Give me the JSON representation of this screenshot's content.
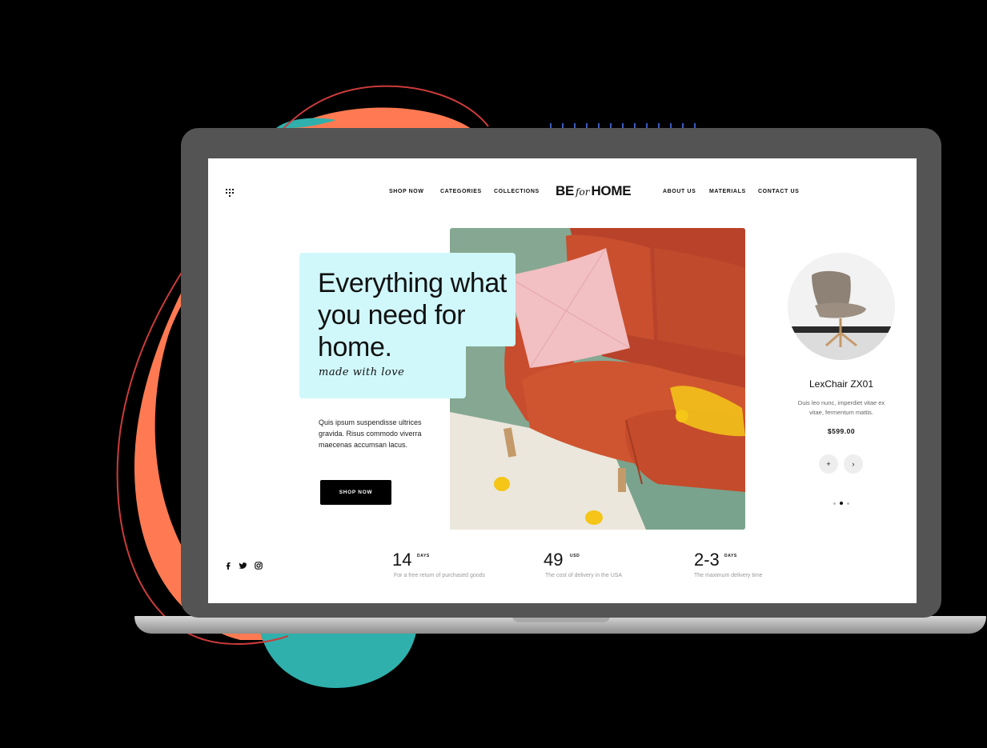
{
  "nav": {
    "left": [
      "SHOP NOW",
      "CATEGORIES",
      "COLLECTIONS"
    ],
    "right": [
      "ABOUT US",
      "MATERIALS",
      "CONTACT US"
    ]
  },
  "logo": {
    "part1": "BE",
    "part2": "for",
    "part3": "HOME"
  },
  "hero": {
    "title": "Everything what you need for home.",
    "script": "made with love",
    "description": "Quis ipsum suspendisse ultrices gravida. Risus commodo viverra maecenas accumsan lacus.",
    "button": "SHOP NOW"
  },
  "product": {
    "name": "LexChair ZX01",
    "description": "Duis leo nunc, imperdiet vitae ex vitae, fermentum mattis.",
    "price": "$599.00",
    "add_label": "+",
    "next_label": "›"
  },
  "stats": [
    {
      "value": "14",
      "unit": "DAYS",
      "label": "For a free return of purchased goods"
    },
    {
      "value": "49",
      "unit": "USD",
      "label": "The cost of delivery in the USA"
    },
    {
      "value": "2-3",
      "unit": "DAYS",
      "label": "The maximum delivery time"
    }
  ],
  "colors": {
    "accent_cyan": "#d0f8fb",
    "blob_orange": "#ff7a52",
    "blob_teal": "#2fb0ac",
    "sofa_orange": "#c8482a",
    "photo_green": "#86a892"
  }
}
